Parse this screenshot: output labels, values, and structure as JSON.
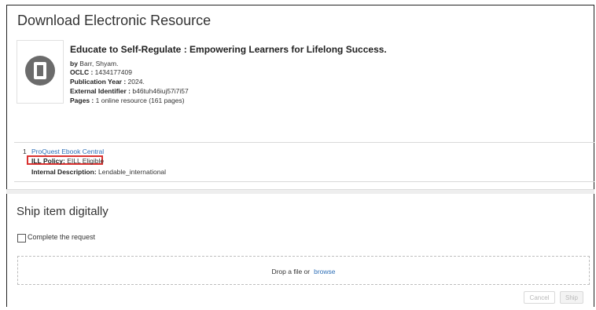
{
  "page": {
    "title": "Download Electronic Resource"
  },
  "item": {
    "title": "Educate to Self-Regulate : Empowering Learners for Lifelong Success.",
    "by_label": "by",
    "by_value": "Barr, Shyam.",
    "oclc_label": "OCLC :",
    "oclc_value": "1434177409",
    "pubyear_label": "Publication Year :",
    "pubyear_value": "2024.",
    "extid_label": "External Identifier :",
    "extid_value": "b46tuh46iuj57i7i57",
    "pages_label": "Pages :",
    "pages_value": "1 online resource (161 pages)"
  },
  "resource": {
    "number": "1",
    "name": "ProQuest Ebook Central",
    "ill_policy_label": "ILL Policy:",
    "ill_policy_value": "EILL Eligible",
    "internal_desc_label": "Internal Description:",
    "internal_desc_value": "Lendable_international"
  },
  "ship": {
    "title": "Ship item digitally",
    "complete_label": "Complete the request",
    "complete_checked": false,
    "drop_text": "Drop a file or",
    "browse_label": "browse",
    "cancel_label": "Cancel",
    "ship_label": "Ship"
  },
  "colors": {
    "link": "#2e6fb7",
    "highlight_border": "#d9312f"
  },
  "icons": {
    "thumbnail": "book-cover-icon"
  }
}
